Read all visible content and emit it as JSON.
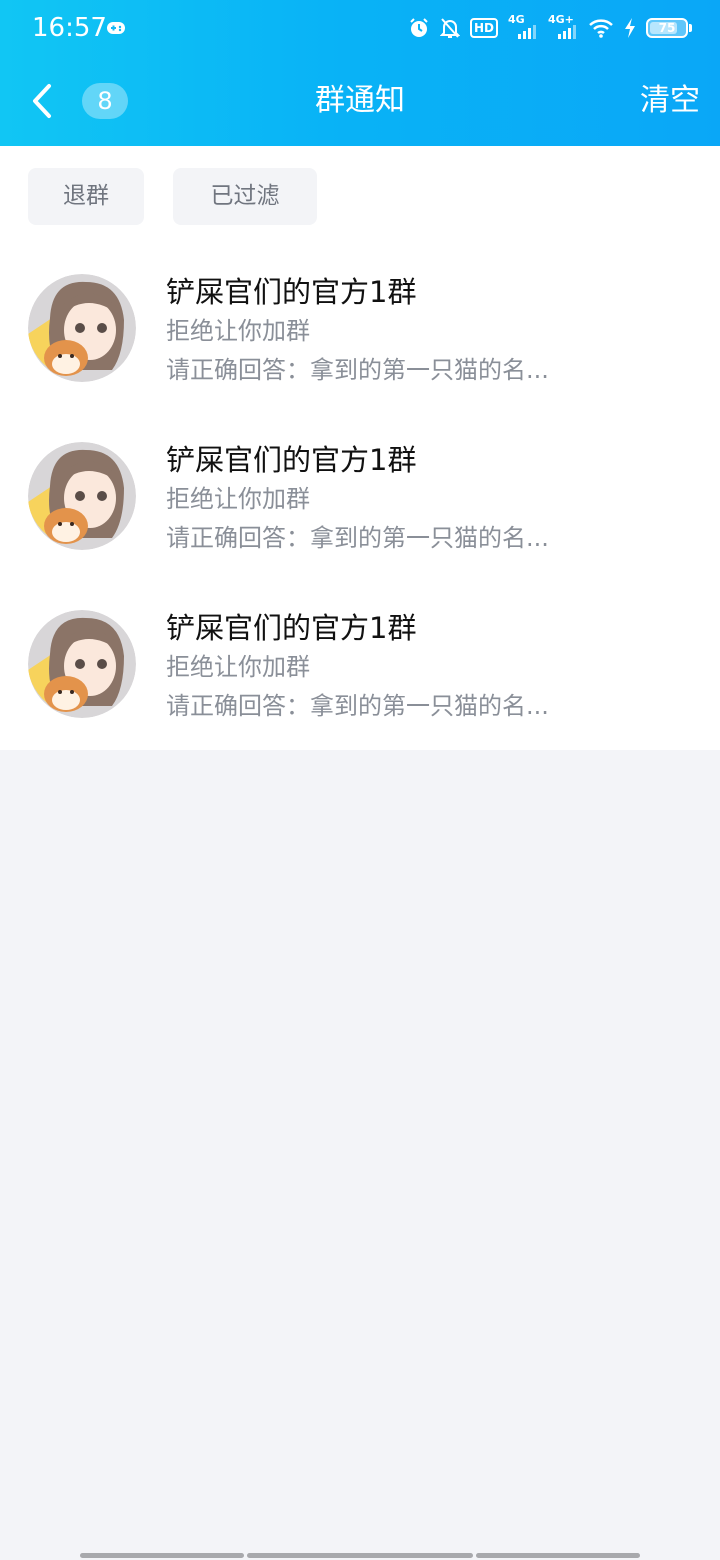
{
  "status_bar": {
    "time": "16:57",
    "network_1": "4G",
    "network_2": "4G+",
    "hd_label": "HD",
    "battery_level": "75",
    "icons": [
      "game-controller-icon",
      "alarm-icon",
      "mute-bell-icon",
      "hd-icon",
      "signal-icon",
      "wifi-icon",
      "charging-icon",
      "battery-icon"
    ]
  },
  "nav": {
    "back_icon": "chevron-left-icon",
    "unread_count": "8",
    "title": "群通知",
    "clear_label": "清空"
  },
  "filters": {
    "quit_group": "退群",
    "filtered": "已过滤"
  },
  "notices": [
    {
      "group_name": "铲屎官们的官方1群",
      "status": "拒绝让你加群",
      "detail": "请正确回答：拿到的第一只猫的名..."
    },
    {
      "group_name": "铲屎官们的官方1群",
      "status": "拒绝让你加群",
      "detail": "请正确回答：拿到的第一只猫的名..."
    },
    {
      "group_name": "铲屎官们的官方1群",
      "status": "拒绝让你加群",
      "detail": "请正确回答：拿到的第一只猫的名..."
    }
  ],
  "colors": {
    "header_start": "#11c6f4",
    "header_end": "#0aa7f7",
    "page_bg": "#f3f4f8",
    "secondary_text": "#8a8f98"
  }
}
